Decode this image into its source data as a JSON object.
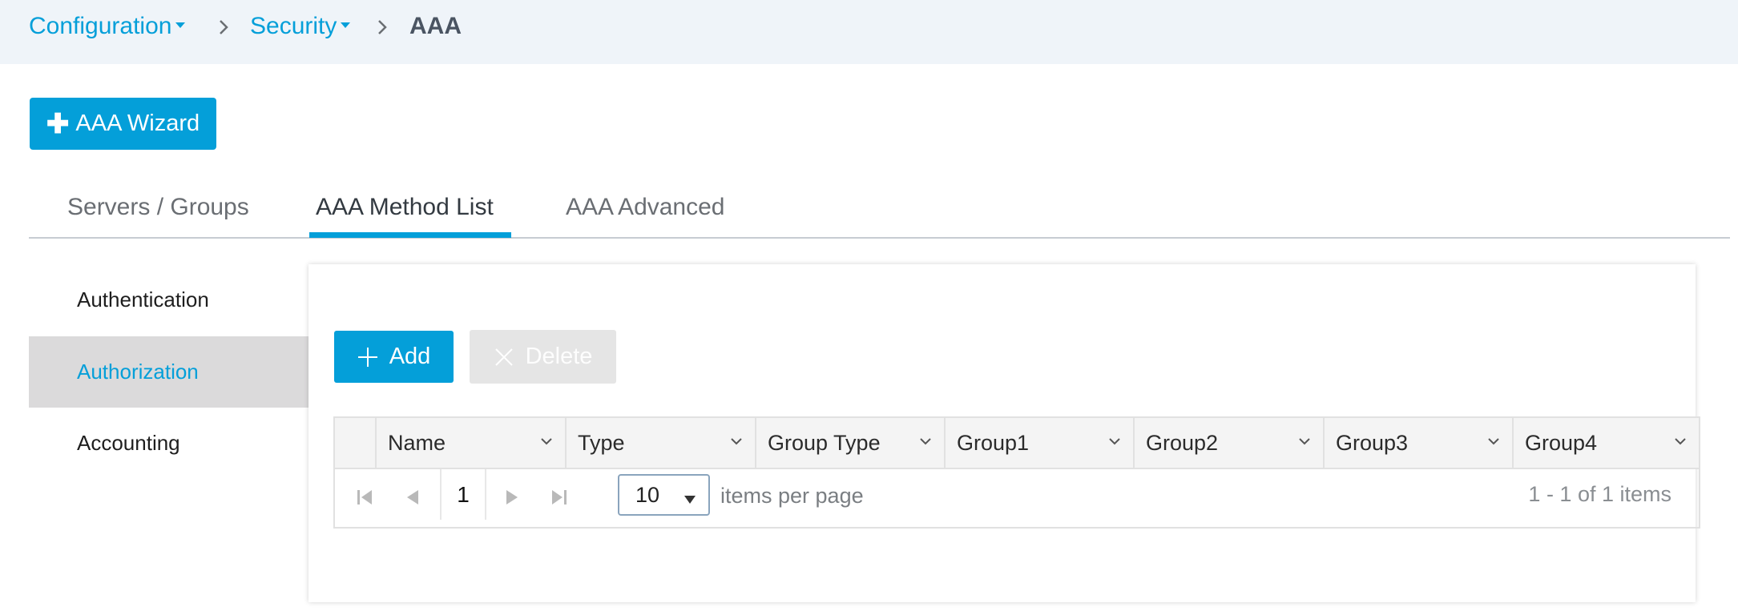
{
  "breadcrumb": {
    "items": [
      {
        "label": "Configuration"
      },
      {
        "label": "Security"
      }
    ],
    "current": "AAA"
  },
  "toolbar": {
    "wizard_label": "AAA Wizard"
  },
  "tabs": [
    {
      "label": "Servers / Groups",
      "active": false
    },
    {
      "label": "AAA Method List",
      "active": true
    },
    {
      "label": "AAA Advanced",
      "active": false
    }
  ],
  "sidebar": {
    "items": [
      {
        "label": "Authentication",
        "active": false
      },
      {
        "label": "Authorization",
        "active": true
      },
      {
        "label": "Accounting",
        "active": false
      }
    ]
  },
  "actions": {
    "add_label": "Add",
    "delete_label": "Delete"
  },
  "table": {
    "columns": [
      "Name",
      "Type",
      "Group Type",
      "Group1",
      "Group2",
      "Group3",
      "Group4"
    ],
    "rows": []
  },
  "pagination": {
    "current_page": "1",
    "page_size": "10",
    "page_size_label": "items per page",
    "info": "1 - 1 of 1 items"
  },
  "colors": {
    "accent": "#049fd9",
    "breadcrumb_bg": "#eff4f9",
    "sidebar_active_bg": "#dbdadb"
  },
  "icons": [
    "chevron-right-icon",
    "caret-down-icon",
    "plus-icon",
    "close-icon",
    "chevron-down-icon",
    "first-page-icon",
    "prev-page-icon",
    "next-page-icon",
    "last-page-icon"
  ]
}
